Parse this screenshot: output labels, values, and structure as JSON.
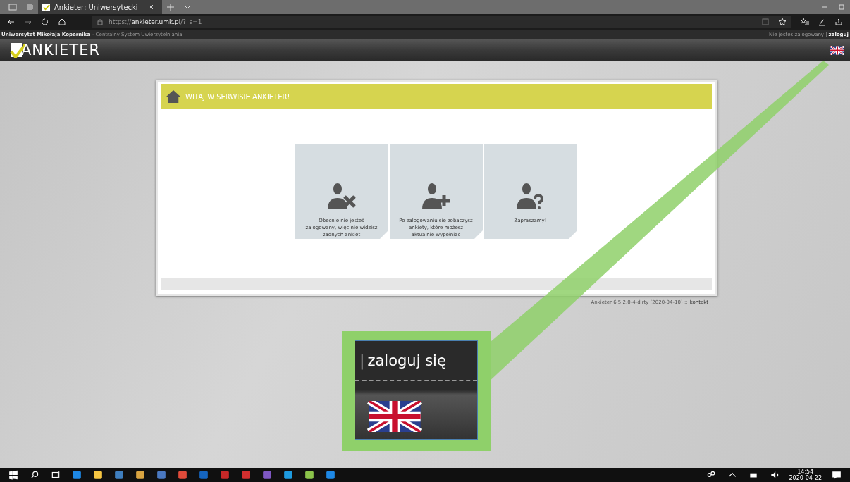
{
  "browser": {
    "tab_title": "Ankieter: Uniwersytecki",
    "url": "https://**ankieter.umk.pl**/?_s=1"
  },
  "top_bar": {
    "org": "Uniwersytet Mikołaja Kopernika",
    "org_suffix": "- Centralny System Uwierzytelniania",
    "status": "Nie jesteś zalogowany |",
    "login": "zaloguj"
  },
  "logo": {
    "text": "ANKIETER"
  },
  "panel": {
    "title": "WITAJ W SERWISIE ANKIETER!",
    "tiles": [
      {
        "kind": "logged-out",
        "text": "Obecnie nie jesteś zalogowany, więc nie widzisz żadnych ankiet"
      },
      {
        "kind": "add",
        "text": "Po zalogowaniu się zobaczysz ankiety, które możesz aktualnie wypełniać"
      },
      {
        "kind": "question",
        "text": "Zapraszamy!"
      }
    ]
  },
  "footer": {
    "version": "Ankieter 6.5.2.0-4-dirty (2020-04-10) ::",
    "link": "kontakt"
  },
  "callout": {
    "separator": "|",
    "text": "zaloguj się"
  },
  "clock": {
    "time": "14:54",
    "date": "2020-04-22"
  }
}
